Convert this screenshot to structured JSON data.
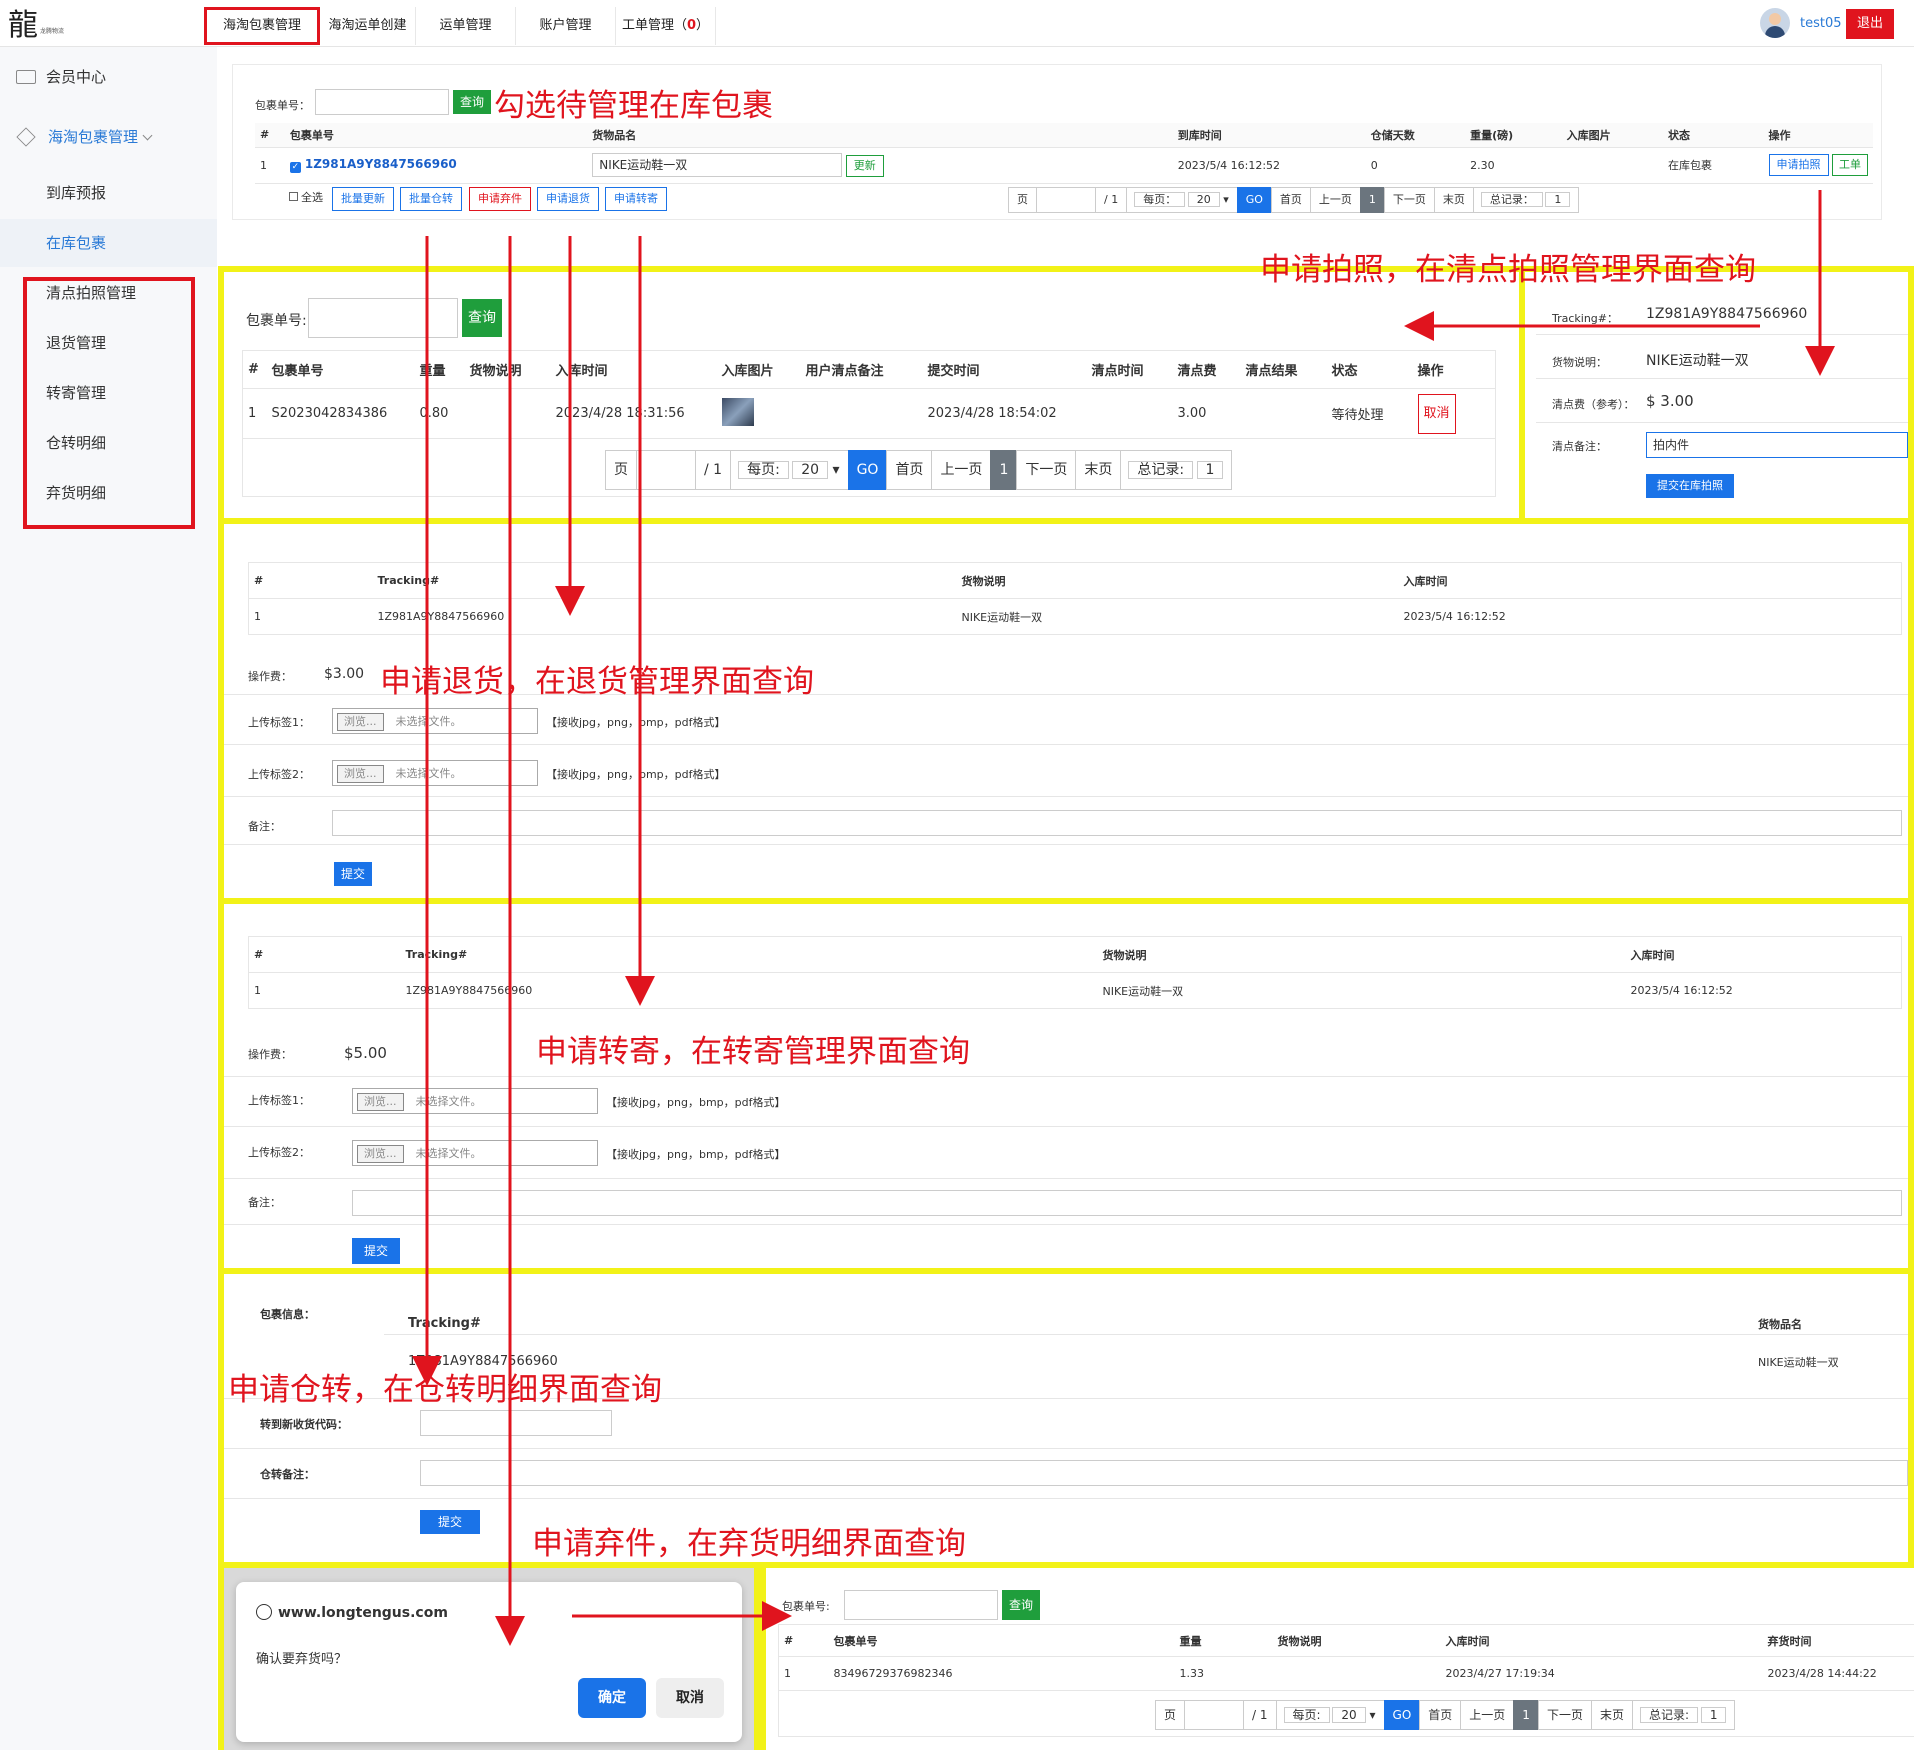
{
  "topbar": {
    "tabs": [
      {
        "label": "海淘包裹管理"
      },
      {
        "label": "海淘运单创建"
      },
      {
        "label": "运单管理"
      },
      {
        "label": "账户管理"
      },
      {
        "label": "工单管理（",
        "count": "0",
        "suffix": "）"
      }
    ],
    "username": "test05",
    "logout": "退出"
  },
  "sidebar": {
    "member_center": "会员中心",
    "parcel_mgmt": "海淘包裹管理",
    "items": [
      "到库预报",
      "在库包裹",
      "清点拍照管理",
      "退货管理",
      "转寄管理",
      "仓转明细",
      "弃货明细"
    ]
  },
  "main": {
    "search_label": "包裹单号：",
    "search_button": "查询",
    "headers": [
      "#",
      "包裹单号",
      "货物品名",
      "到库时间",
      "仓储天数",
      "重量(磅)",
      "入库图片",
      "状态",
      "操作"
    ],
    "row": {
      "index": "1",
      "tracking": "1Z981A9Y8847566960",
      "goods": "NIKE运动鞋一双",
      "update": "更新",
      "arrival": "2023/5/4 16:12:52",
      "days": "0",
      "weight": "2.30",
      "status": "在库包裹",
      "photo_btn": "申请拍照",
      "ticket_btn": "工单"
    },
    "select_all": "全选",
    "batch": [
      "批量更新",
      "批量仓转",
      "申请弃件",
      "申请退货",
      "申请转寄"
    ],
    "pager": {
      "page": "页",
      "of": "/ 1",
      "per_page": "每页：",
      "per_value": "20",
      "go": "GO",
      "first": "首页",
      "prev": "上一页",
      "current": "1",
      "next": "下一页",
      "last": "末页",
      "total_label": "总记录：",
      "total": "1"
    }
  },
  "annotations": {
    "a1": "勾选待管理在库包裹",
    "a2": "申请拍照，在清点拍照管理界面查询",
    "a3": "申请退货，在退货管理界面查询",
    "a4": "申请转寄，在转寄管理界面查询",
    "a5": "申请仓转，在仓转明细界面查询",
    "a6": "申请弃件，在弃货明细界面查询"
  },
  "photo": {
    "search_label": "包裹单号:",
    "search_button": "查询",
    "headers": [
      "#",
      "包裹单号",
      "重量",
      "货物说明",
      "入库时间",
      "入库图片",
      "用户清点备注",
      "提交时间",
      "清点时间",
      "清点费",
      "清点结果",
      "状态",
      "操作"
    ],
    "row": {
      "index": "1",
      "tracking": "S2023042834386",
      "weight": "0.80",
      "goods": "",
      "in_time": "2023/4/28 18:31:56",
      "note": "",
      "submit": "2023/4/28 18:54:02",
      "check_time": "",
      "fee": "3.00",
      "result": "",
      "status": "等待处理",
      "cancel": "取消"
    },
    "pager": {
      "page": "页",
      "of": "/ 1",
      "per_page": "每页:",
      "per_value": "20",
      "go": "GO",
      "first": "首页",
      "prev": "上一页",
      "current": "1",
      "next": "下一页",
      "last": "末页",
      "total_label": "总记录:",
      "total": "1"
    }
  },
  "photo_form": {
    "tracking_label": "Tracking#：",
    "tracking": "1Z981A9Y8847566960",
    "goods_label": "货物说明：",
    "goods": "NIKE运动鞋一双",
    "fee_label": "清点费（参考）：",
    "fee": "$ 3.00",
    "note_label": "清点备注：",
    "note": "拍内件",
    "submit": "提交在库拍照"
  },
  "return_form": {
    "headers": [
      "#",
      "Tracking#",
      "货物说明",
      "入库时间"
    ],
    "row": {
      "index": "1",
      "tracking": "1Z981A9Y8847566960",
      "goods": "NIKE运动鞋一双",
      "time": "2023/5/4 16:12:52"
    },
    "fee_label": "操作费：",
    "fee": "$3.00",
    "label1": "上传标签1：",
    "label2": "上传标签2：",
    "browse": "浏览...",
    "no_file": "未选择文件。",
    "hint": "【接收jpg，png，bmp，pdf格式】",
    "note_label": "备注：",
    "submit": "提交"
  },
  "forward_form": {
    "headers": [
      "#",
      "Tracking#",
      "货物说明",
      "入库时间"
    ],
    "row": {
      "index": "1",
      "tracking": "1Z981A9Y8847566960",
      "goods": "NIKE运动鞋一双",
      "time": "2023/5/4 16:12:52"
    },
    "fee_label": "操作费：",
    "fee": "$5.00",
    "label1": "上传标签1：",
    "label2": "上传标签2：",
    "browse": "浏览...",
    "no_file": "未选择文件。",
    "hint": "【接收jpg，png，bmp，pdf格式】",
    "note_label": "备注：",
    "submit": "提交"
  },
  "transfer_form": {
    "info_label": "包裹信息：",
    "col_tracking": "Tracking#",
    "col_goods": "货物品名",
    "tracking": "1Z981A9Y8847566960",
    "goods": "NIKE运动鞋一双",
    "code_label": "转到新收货代码：",
    "note_label": "仓转备注：",
    "submit": "提交"
  },
  "dialog": {
    "site": "www.longtengus.com",
    "message": "确认要弃货吗？",
    "ok": "确定",
    "cancel": "取消"
  },
  "abandon": {
    "search_label": "包裹单号:",
    "search_button": "查询",
    "headers": [
      "#",
      "包裹单号",
      "重量",
      "货物说明",
      "入库时间",
      "弃货时间"
    ],
    "row": {
      "index": "1",
      "tracking": "83496729376982346",
      "weight": "1.33",
      "goods": "",
      "in_time": "2023/4/27 17:19:34",
      "abandon_time": "2023/4/28 14:44:22"
    },
    "pager": {
      "page": "页",
      "of": "/ 1",
      "per_page": "每页:",
      "per_value": "20",
      "go": "GO",
      "first": "首页",
      "prev": "上一页",
      "current": "1",
      "next": "下一页",
      "last": "末页",
      "total_label": "总记录:",
      "total": "1"
    }
  },
  "colors": {
    "annotation_red": "#e0141e",
    "panel_yellow": "#f2f218",
    "primary_blue": "#1a73e8",
    "green": "#1f9e3c"
  }
}
